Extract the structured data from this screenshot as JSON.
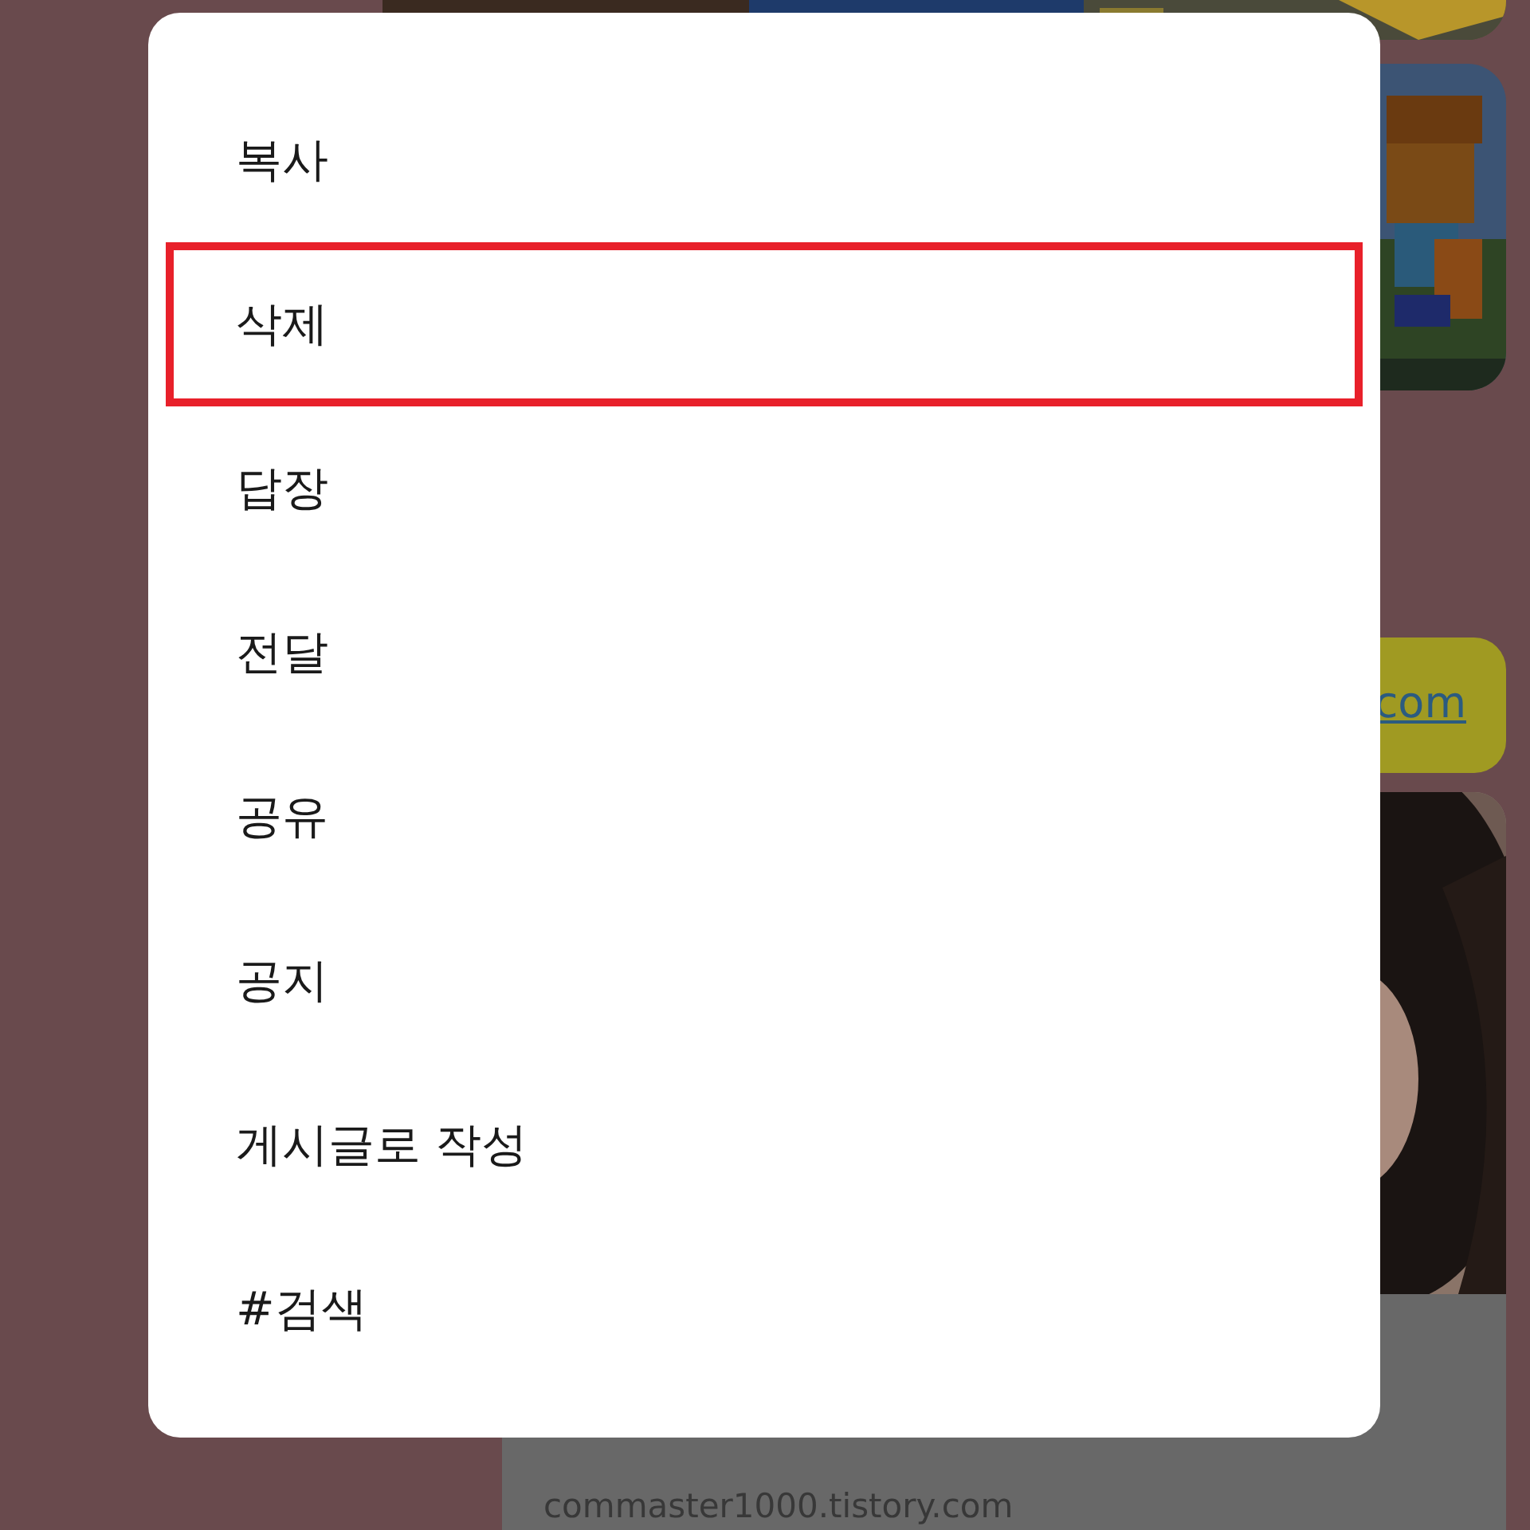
{
  "chat": {
    "link_bubble": {
      "text": "com"
    },
    "link_card": {
      "site": "commaster1000.tistory.com"
    }
  },
  "menu": {
    "items": [
      {
        "label": "복사",
        "selected": false
      },
      {
        "label": "삭제",
        "selected": true
      },
      {
        "label": "답장",
        "selected": false
      },
      {
        "label": "전달",
        "selected": false
      },
      {
        "label": "공유",
        "selected": false
      },
      {
        "label": "공지",
        "selected": false
      },
      {
        "label": "게시글로 작성",
        "selected": false
      },
      {
        "label": "#검색",
        "selected": false
      }
    ]
  }
}
